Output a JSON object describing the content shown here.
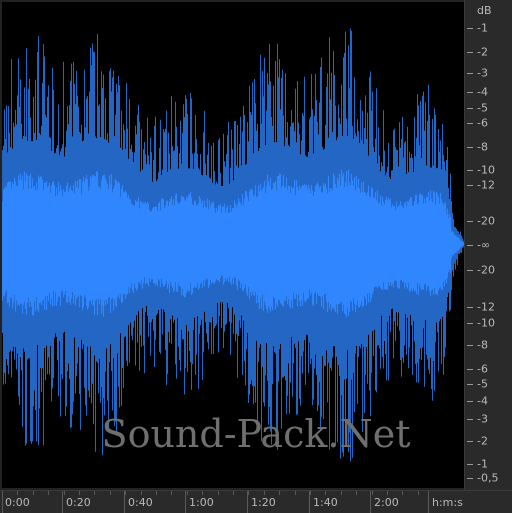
{
  "watermark": "Sound-Pack.Net",
  "colors": {
    "waveform": "#2f86ff",
    "background": "#000000",
    "ruler": "#2a2a2a",
    "ruler_text": "#b8b8b8"
  },
  "amplitude_ruler": {
    "unit": "dB",
    "labels": [
      "-1",
      "-2",
      "-3",
      "-4",
      "-5",
      "-6",
      "-8",
      "-10",
      "-12",
      "-20",
      "-∞",
      "-20",
      "-12",
      "-10",
      "-8",
      "-6",
      "-5",
      "-4",
      "-3",
      "-2",
      "-1",
      "-0,5"
    ]
  },
  "time_ruler": {
    "labels": [
      "0:00",
      "0:20",
      "0:40",
      "1:00",
      "1:20",
      "1:40",
      "2:00"
    ],
    "unit": "h:m:s"
  }
}
